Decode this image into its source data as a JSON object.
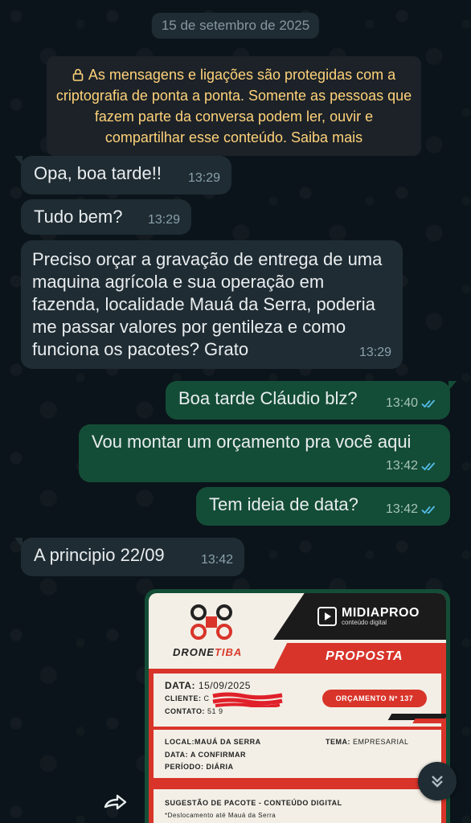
{
  "chat": {
    "date_chip": "15 de setembro de 2025",
    "encryption_notice": "As mensagens e ligações são protegidas com a criptografia de ponta a ponta. Somente as pessoas que fazem parte da conversa podem ler, ouvir e compartilhar esse conteúdo. Saiba mais",
    "messages": [
      {
        "direction": "in",
        "text": "Opa, boa tarde!!",
        "time": "13:29"
      },
      {
        "direction": "in",
        "text": "Tudo bem?",
        "time": "13:29"
      },
      {
        "direction": "in",
        "text": "Preciso orçar a gravação de entrega de uma maquina agrícola e sua operação em fazenda, localidade Mauá da Serra, poderia me passar valores por gentileza e como funciona os pacotes? Grato",
        "time": "13:29"
      },
      {
        "direction": "out",
        "text": "Boa tarde Cláudio blz?",
        "time": "13:40",
        "status": "read"
      },
      {
        "direction": "out",
        "text": "Vou montar um orçamento pra você aqui",
        "time": "13:42",
        "status": "read"
      },
      {
        "direction": "out",
        "text": "Tem ideia de data?",
        "time": "13:42",
        "status": "read"
      },
      {
        "direction": "in",
        "text": "A principio 22/09",
        "time": "13:42"
      }
    ]
  },
  "document_preview": {
    "brand_left": {
      "part1": "DRONE",
      "part2": "TIBA"
    },
    "brand_right": {
      "title": "MIDIAPROO",
      "subtitle": "conteúdo digital"
    },
    "heading": "PROPOSTA",
    "data_label": "DATA:",
    "data_value": "15/09/2025",
    "cliente_label": "CLIENTE:",
    "cliente_value": "C",
    "contato_label": "CONTATO:",
    "contato_value": "51 9",
    "orcamento": "ORÇAMENTO Nº 137",
    "local_label": "LOCAL:",
    "local_value": "MAUÁ DA SERRA",
    "tema_label": "TEMA:",
    "tema_value": "EMPRESARIAL",
    "data2_label": "DATA:",
    "data2_value": "A CONFIRMAR",
    "periodo_label": "PERÍODO:",
    "periodo_value": "DIÁRIA",
    "sugestao": "SUGESTÃO DE PACOTE - CONTEÚDO DIGITAL",
    "deslocamento": "*Deslocamento até Mauá da Serra"
  },
  "icons": {
    "lock": "lock-icon",
    "read_ticks": "double-check-icon",
    "scroll_down": "chevrons-down-icon",
    "forward": "forward-icon"
  },
  "colors": {
    "incoming_bubble": "#1f2c33",
    "outgoing_bubble": "#144d37",
    "read_ticks": "#53bdeb",
    "encryption_text": "#ffd279"
  }
}
